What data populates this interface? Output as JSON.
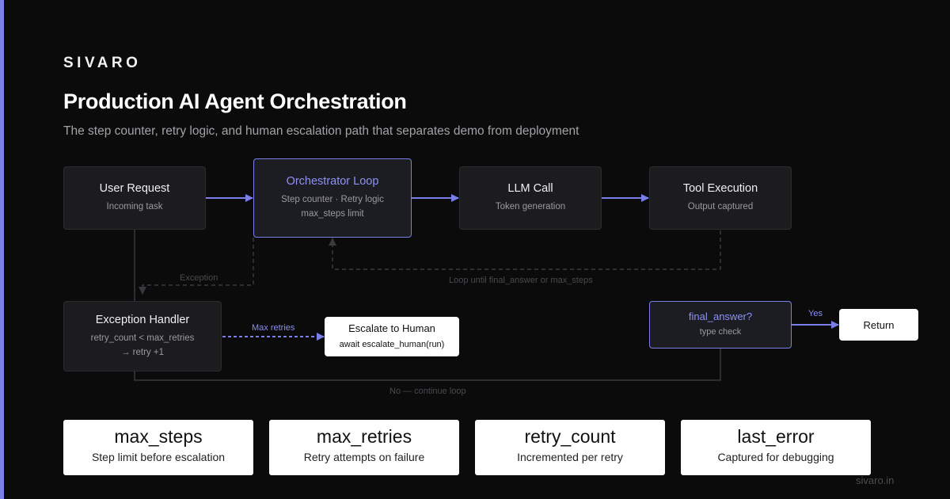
{
  "brand": "SIVARO",
  "title": "Production AI Agent Orchestration",
  "subtitle": "The step counter, retry logic, and human escalation path that separates demo from deployment",
  "colors": {
    "accent": "#7b7fe8",
    "background": "#0b0b0c",
    "node": "#1c1c1f"
  },
  "nodes": {
    "user_request": {
      "title": "User Request",
      "sub": "Incoming task"
    },
    "orchestrator": {
      "title": "Orchestrator Loop",
      "sub1": "Step counter · Retry logic",
      "sub2": "max_steps limit"
    },
    "llm_call": {
      "title": "LLM Call",
      "sub": "Token generation"
    },
    "tool_execution": {
      "title": "Tool Execution",
      "sub": "Output captured"
    },
    "exception_handler": {
      "title": "Exception Handler",
      "sub1": "retry_count < max_retries",
      "sub2": "→ retry +1"
    },
    "escalate": {
      "title": "Escalate to Human",
      "sub": "await escalate_human(run)"
    },
    "final_answer": {
      "title": "final_answer?",
      "sub": "type check"
    },
    "return": {
      "title": "Return"
    }
  },
  "edge_labels": {
    "exception": "Exception",
    "loop": "Loop until final_answer or max_steps",
    "max_retries": "Max retries",
    "yes": "Yes",
    "no": "No — continue loop"
  },
  "cards": [
    {
      "name": "max_steps",
      "desc": "Step limit before escalation"
    },
    {
      "name": "max_retries",
      "desc": "Retry attempts on failure"
    },
    {
      "name": "retry_count",
      "desc": "Incremented per retry"
    },
    {
      "name": "last_error",
      "desc": "Captured for debugging"
    }
  ],
  "footer": "sivaro.in"
}
